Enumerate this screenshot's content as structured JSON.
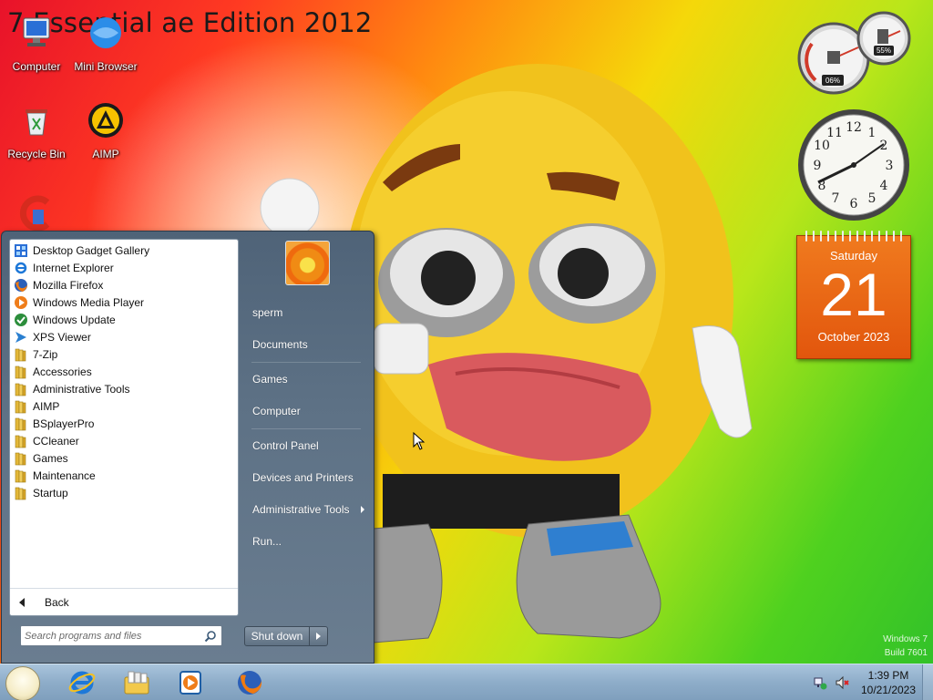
{
  "desktop": {
    "title": "7 Essential ae Edition 2012",
    "icons": [
      {
        "label": "Computer",
        "icon": "computer-icon"
      },
      {
        "label": "Mini Browser",
        "icon": "mini-browser-icon"
      },
      {
        "label": "Recycle Bin",
        "icon": "recycle-bin-icon"
      },
      {
        "label": "AIMP",
        "icon": "aimp-icon"
      },
      {
        "label": "",
        "icon": "ccleaner-icon"
      }
    ],
    "watermark": {
      "line1": "Windows 7",
      "line2": "Build 7601"
    }
  },
  "gadgets": {
    "cpu_meter": {
      "cpu": "06%",
      "memory": "55%"
    },
    "clock": {
      "time": "1:39"
    },
    "calendar": {
      "weekday": "Saturday",
      "day": "21",
      "month_year": "October 2023"
    }
  },
  "start_menu": {
    "programs": [
      {
        "label": "Desktop Gadget Gallery",
        "icon": "gadget-gallery-icon"
      },
      {
        "label": "Internet Explorer",
        "icon": "internet-explorer-icon"
      },
      {
        "label": "Mozilla Firefox",
        "icon": "firefox-icon"
      },
      {
        "label": "Windows Media Player",
        "icon": "media-player-icon"
      },
      {
        "label": "Windows Update",
        "icon": "windows-update-icon"
      },
      {
        "label": "XPS Viewer",
        "icon": "xps-viewer-icon"
      },
      {
        "label": "7-Zip",
        "icon": "folder-icon"
      },
      {
        "label": "Accessories",
        "icon": "folder-icon"
      },
      {
        "label": "Administrative Tools",
        "icon": "folder-icon"
      },
      {
        "label": "AIMP",
        "icon": "folder-icon"
      },
      {
        "label": "BSplayerPro",
        "icon": "folder-icon"
      },
      {
        "label": "CCleaner",
        "icon": "folder-icon"
      },
      {
        "label": "Games",
        "icon": "folder-icon"
      },
      {
        "label": "Maintenance",
        "icon": "folder-icon"
      },
      {
        "label": "Startup",
        "icon": "folder-icon"
      }
    ],
    "back_label": "Back",
    "search_placeholder": "Search programs and files",
    "right": {
      "user": "sperm",
      "documents": "Documents",
      "games": "Games",
      "computer": "Computer",
      "control_panel": "Control Panel",
      "devices": "Devices and Printers",
      "admin_tools": "Administrative Tools",
      "run": "Run..."
    },
    "shutdown_label": "Shut down"
  },
  "taskbar": {
    "pinned": [
      "internet-explorer-icon",
      "libraries-icon",
      "media-player-icon",
      "firefox-icon"
    ],
    "clock_time": "1:39 PM",
    "clock_date": "10/21/2023"
  },
  "colors": {
    "start_menu_bg": "#5d7185",
    "calendar_orange": "#e9661a",
    "taskbar_blue": "#8eadc9"
  }
}
